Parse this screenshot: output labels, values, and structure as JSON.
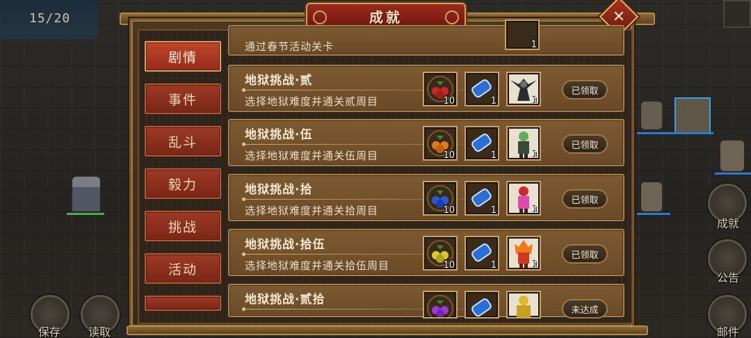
{
  "counter": "15/20",
  "dialog": {
    "title": "成就",
    "close_icon": "close-icon"
  },
  "categories": [
    {
      "label": "剧情",
      "active": true
    },
    {
      "label": "事件"
    },
    {
      "label": "乱斗"
    },
    {
      "label": "毅力"
    },
    {
      "label": "挑战"
    },
    {
      "label": "活动"
    },
    {
      "label": ""
    }
  ],
  "achievements": [
    {
      "title": "",
      "description": "通过春节活动关卡",
      "rewards": [
        {
          "icon": "gift-icon",
          "qty": "1"
        }
      ],
      "status": ""
    },
    {
      "title": "地狱挑战·贰",
      "description": "选择地狱难度并通关贰周目",
      "rewards": [
        {
          "icon": "red-fruit-icon",
          "qty": "10"
        },
        {
          "icon": "blue-scroll-icon",
          "qty": "1"
        },
        {
          "icon": "dark-winged-hero-portrait",
          "qty": "1"
        }
      ],
      "status": "已领取"
    },
    {
      "title": "地狱挑战·伍",
      "description": "选择地狱难度并通关伍周目",
      "rewards": [
        {
          "icon": "orange-fruit-icon",
          "qty": "10"
        },
        {
          "icon": "blue-scroll-icon",
          "qty": "1"
        },
        {
          "icon": "green-hair-hero-portrait",
          "qty": "1"
        }
      ],
      "status": "已领取"
    },
    {
      "title": "地狱挑战·拾",
      "description": "选择地狱难度并通关拾周目",
      "rewards": [
        {
          "icon": "blue-fruit-icon",
          "qty": "10"
        },
        {
          "icon": "blue-scroll-icon",
          "qty": "1"
        },
        {
          "icon": "red-hair-hero-portrait",
          "qty": "1"
        }
      ],
      "status": "已领取"
    },
    {
      "title": "地狱挑战·拾伍",
      "description": "选择地狱难度并通关拾伍周目",
      "rewards": [
        {
          "icon": "yellow-fruit-icon",
          "qty": "10"
        },
        {
          "icon": "blue-scroll-icon",
          "qty": "1"
        },
        {
          "icon": "fire-hero-portrait",
          "qty": "1"
        }
      ],
      "status": "已领取"
    },
    {
      "title": "地狱挑战·贰拾",
      "description": "",
      "rewards": [
        {
          "icon": "purple-fruit-icon",
          "qty": ""
        },
        {
          "icon": "blue-scroll-icon",
          "qty": ""
        },
        {
          "icon": "golden-armor-hero-portrait",
          "qty": ""
        }
      ],
      "status": "未达成"
    }
  ],
  "hud": {
    "left_buttons": [
      {
        "label": "保存"
      },
      {
        "label": "读取"
      }
    ],
    "right_buttons": [
      {
        "label": "成就"
      },
      {
        "label": "公告"
      },
      {
        "label": "邮件"
      }
    ]
  },
  "colors": {
    "accent_red": "#9b3a25",
    "gold_border": "#caa35f",
    "row_bg": "#7c5a32"
  }
}
